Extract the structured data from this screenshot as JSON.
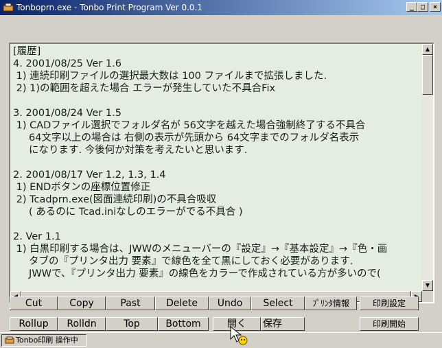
{
  "window": {
    "title": "Tonboprn.exe - Tonbo Print Program Ver 0.0.1",
    "controls": {
      "minimize": "_",
      "maximize": "□",
      "close": "×"
    }
  },
  "log_lines": [
    "[履歴]",
    "4. 2001/08/25 Ver 1.6",
    " 1) 連続印刷ファイルの選択最大数は 100 ファイルまで拡張しました.",
    " 2) 1)の範囲を超えた場合 エラーが発生していた不具合Fix",
    "",
    "3. 2001/08/24 Ver 1.5",
    " 1) CADファイル選択でフォルダ名が 56文字を越えた場合強制終了する不具合",
    "     64文字以上の場合は 右側の表示が先頭から 64文字までのフォルダ名表示",
    "     になります. 今後何か対策を考えたいと思います.",
    "",
    "2. 2001/08/17 Ver 1.2, 1.3, 1.4",
    " 1) ENDボタンの座標位置修正",
    " 2) Tcadprn.exe(図面連続印刷)の不具合吸収",
    "     ( あるのに Tcad.iniなしのエラーがでる不具合 )",
    "",
    "2. Ver 1.1",
    " 1) 白黒印刷する場合は、JWWのメニューバーの『設定』→『基本設定』→『色・画",
    "     タブの『プリンタ出力 要素』で線色を全て黒にしておく必要があります.",
    "     JWWで、『プリンタ出力 要素』の線色をカラーで作成されている方が多いので("
  ],
  "toolbar_row1": [
    "Cut",
    "Copy",
    "Past",
    "Delete",
    "Undo",
    "Select",
    "ﾌﾟﾘﾝﾀ情報",
    "印刷設定"
  ],
  "toolbar_row2": [
    "Rollup",
    "Rolldn",
    "Top",
    "Bottom",
    "開く",
    "保存",
    "印刷開始"
  ],
  "taskbar": {
    "item_label": "Tonbo印刷 操作中"
  },
  "scroll_arrows": {
    "up": "▲",
    "down": "▼",
    "left": "◀",
    "right": "▶"
  },
  "colors": {
    "titlebar_start": "#0a246a",
    "titlebar_end": "#a6caf0",
    "text_background": "#e3eee0",
    "face": "#d4d0c8"
  }
}
